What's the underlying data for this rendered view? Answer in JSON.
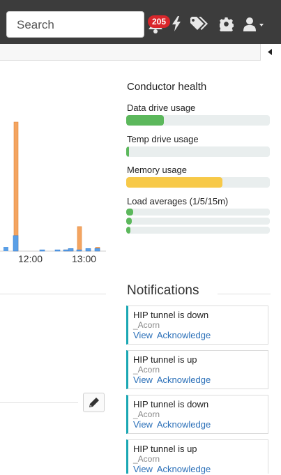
{
  "topbar": {
    "search_placeholder": "Search",
    "notification_count": "205",
    "icons": [
      "bell-icon",
      "bolt-icon",
      "tags-icon",
      "gear-icon",
      "user-icon"
    ]
  },
  "chart": {
    "x_ticks": [
      "12:00",
      "13:00"
    ]
  },
  "chart_data": {
    "type": "bar",
    "x_ticks": [
      "12:00",
      "13:00"
    ],
    "series": [
      {
        "color": "#f4a460",
        "values": [
          100,
          0,
          0,
          1,
          1,
          19,
          1,
          3
        ]
      },
      {
        "color": "#5a9fe6",
        "values": [
          12,
          1,
          1,
          1,
          2,
          1,
          2,
          2
        ]
      }
    ]
  },
  "health": {
    "title": "Conductor health",
    "metrics": [
      {
        "label": "Data drive usage",
        "value": 26,
        "color": "#5cb85c"
      },
      {
        "label": "Temp drive usage",
        "value": 2,
        "color": "#5cb85c"
      },
      {
        "label": "Memory usage",
        "value": 67,
        "color": "#f7c948"
      },
      {
        "label": "Load averages (1/5/15m)",
        "values": [
          5,
          4,
          3
        ],
        "color": "#5cb85c"
      }
    ]
  },
  "notifications": {
    "title": "Notifications",
    "items": [
      {
        "title": "HIP tunnel is down",
        "sub": "_Acorn",
        "view": "View",
        "ack": "Acknowledge"
      },
      {
        "title": "HIP tunnel is up",
        "sub": "_Acorn",
        "view": "View",
        "ack": "Acknowledge"
      },
      {
        "title": "HIP tunnel is down",
        "sub": "_Acorn",
        "view": "View",
        "ack": "Acknowledge"
      },
      {
        "title": "HIP tunnel is up",
        "sub": "_Acorn",
        "view": "View",
        "ack": "Acknowledge"
      }
    ]
  },
  "colors": {
    "accent": "#1aa7b3",
    "link": "#2a6fb8",
    "badge": "#d9262b"
  }
}
